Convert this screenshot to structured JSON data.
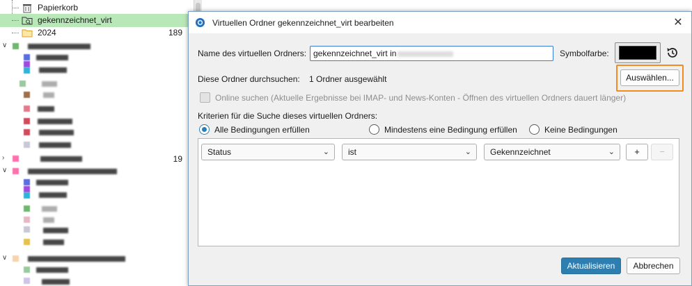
{
  "tree": {
    "trash_label": "Papierkorb",
    "virtual_folder_label": "gekennzeichnet_virt",
    "year_folder_label": "2024",
    "year_folder_count": "189",
    "collapsed_account_count": "19"
  },
  "dialog": {
    "title": "Virtuellen Ordner gekennzeichnet_virt bearbeiten",
    "name_label": "Name des virtuellen Ordners:",
    "name_value": "gekennzeichnet_virt in",
    "color_label": "Symbolfarbe:",
    "color_value": "#000000",
    "search_folders_label": "Diese Ordner durchsuchen:",
    "selected_folders_text": "1 Ordner ausgewählt",
    "select_button": "Auswählen...",
    "online_search_label": "Online suchen (Aktuelle Ergebnisse bei IMAP- und News-Konten - Öffnen des virtuellen Ordners dauert länger)",
    "criteria_heading": "Kriterien für die Suche dieses virtuellen Ordners:",
    "match_all": "Alle Bedingungen erfüllen",
    "match_any": "Mindestens eine Bedingung erfüllen",
    "match_none": "Keine Bedingungen",
    "criterion": {
      "field": "Status",
      "operator": "ist",
      "value": "Gekennzeichnet"
    },
    "add_button": "+",
    "remove_button": "−",
    "update_button": "Aktualisieren",
    "cancel_button": "Abbrechen"
  },
  "colors": {
    "selection": "#b8e8b8",
    "accent": "#2e7fb1",
    "highlight": "#f28c1e"
  },
  "icons": [
    "trash-icon",
    "virtual-folder-icon",
    "folder-icon",
    "app-icon",
    "close-icon",
    "reset-color-icon",
    "chevron-down-icon",
    "chevron-right-icon"
  ]
}
